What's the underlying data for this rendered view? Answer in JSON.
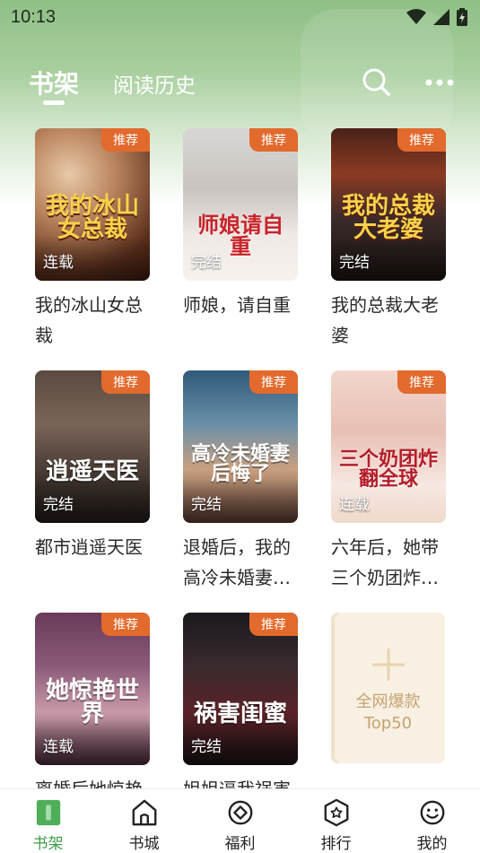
{
  "status_bar": {
    "time": "10:13"
  },
  "header": {
    "tabs": [
      {
        "label": "书架",
        "active": true
      },
      {
        "label": "阅读历史",
        "active": false
      }
    ]
  },
  "colors": {
    "accent": "#3e9a4a",
    "badge": "#e26a2c",
    "header_green": "#8fbf86"
  },
  "books": [
    {
      "title": "我的冰山女总裁",
      "status": "连载",
      "badge": "推荐",
      "cover_text": "我的冰山女总裁"
    },
    {
      "title": "师娘，请自重",
      "status": "完结",
      "badge": "推荐",
      "cover_text": "师娘请自重"
    },
    {
      "title": "我的总裁大老婆",
      "status": "完结",
      "badge": "推荐",
      "cover_text": "我的总裁大老婆"
    },
    {
      "title": "都市逍遥天医",
      "status": "完结",
      "badge": "推荐",
      "cover_text": "逍遥天医"
    },
    {
      "title": "退婚后，我的高冷未婚妻…",
      "status": "完结",
      "badge": "推荐",
      "cover_text": "高冷未婚妻后悔了"
    },
    {
      "title": "六年后，她带三个奶团炸…",
      "status": "连载",
      "badge": "推荐",
      "cover_text": "三个奶团炸翻全球"
    },
    {
      "title": "离婚后她惊艳",
      "status": "连载",
      "badge": "推荐",
      "cover_text": "她惊艳世界"
    },
    {
      "title": "姐姐逼我祸害",
      "status": "完结",
      "badge": "推荐",
      "cover_text": "祸害闺蜜"
    }
  ],
  "top50": {
    "line1": "全网爆款",
    "line2": "Top50"
  },
  "bottom_nav": [
    {
      "label": "书架",
      "icon": "bookshelf-icon",
      "active": true
    },
    {
      "label": "书城",
      "icon": "bookstore-icon",
      "active": false
    },
    {
      "label": "福利",
      "icon": "welfare-icon",
      "active": false
    },
    {
      "label": "排行",
      "icon": "ranking-icon",
      "active": false
    },
    {
      "label": "我的",
      "icon": "profile-icon",
      "active": false
    }
  ]
}
